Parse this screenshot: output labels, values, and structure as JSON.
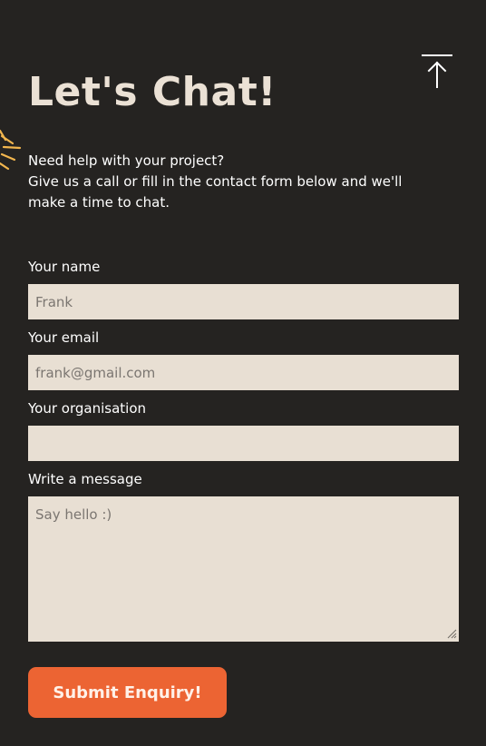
{
  "header": {
    "title": "Let's Chat!"
  },
  "intro": {
    "line1": "Need help with your project?",
    "line2": "Give us a call or fill in the contact form below and we'll",
    "line3": "make a time to chat."
  },
  "form": {
    "name": {
      "label": "Your name",
      "placeholder": "Frank",
      "value": ""
    },
    "email": {
      "label": "Your email",
      "placeholder": "frank@gmail.com",
      "value": ""
    },
    "organisation": {
      "label": "Your organisation",
      "placeholder": "",
      "value": ""
    },
    "message": {
      "label": "Write a message",
      "placeholder": "Say hello :)",
      "value": ""
    },
    "submit_label": "Submit Enquiry!"
  },
  "icons": {
    "back_to_top": "arrow-up-to-line-icon",
    "decoration": "sunburst-icon"
  },
  "colors": {
    "background": "#252321",
    "title": "#ebe1d5",
    "field_background": "#e8dfd3",
    "accent": "#ec6433",
    "sunburst": "#f2b64e"
  }
}
